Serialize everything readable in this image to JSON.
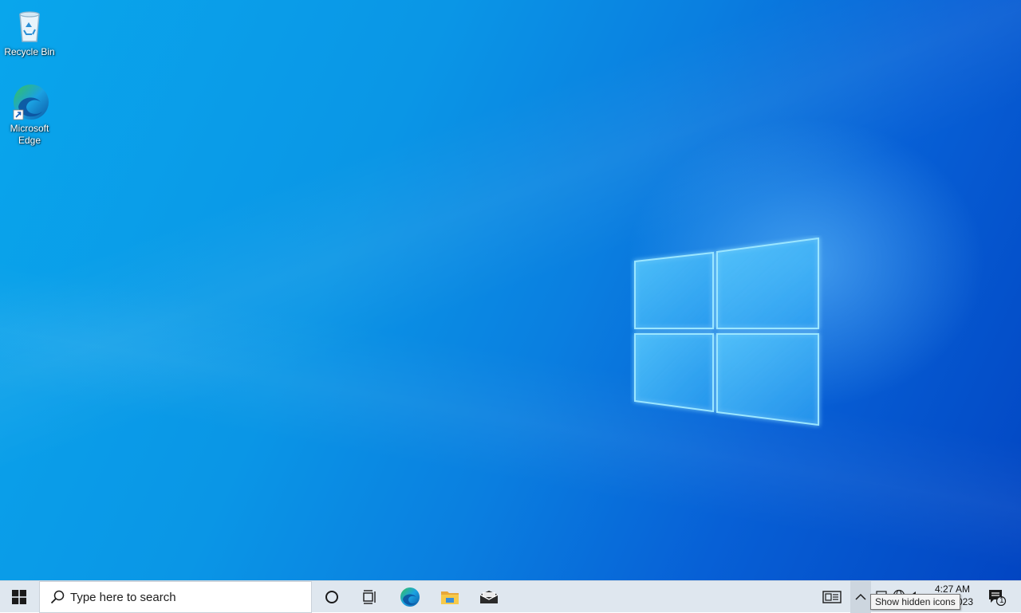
{
  "desktop": {
    "icons": [
      {
        "label": "Recycle Bin",
        "icon": "recycle-bin-icon"
      },
      {
        "label": "Microsoft Edge",
        "icon": "edge-icon"
      }
    ]
  },
  "taskbar": {
    "start_icon": "windows-start-icon",
    "search_placeholder": "Type here to search",
    "pinned": [
      {
        "name": "Cortana",
        "icon": "cortana-icon"
      },
      {
        "name": "Task View",
        "icon": "task-view-icon"
      },
      {
        "name": "Microsoft Edge",
        "icon": "edge-icon"
      },
      {
        "name": "File Explorer",
        "icon": "folder-icon"
      },
      {
        "name": "Mail",
        "icon": "mail-icon"
      }
    ],
    "tray": {
      "news_icon": "news-widget-icon",
      "chevron_icon": "chevron-up-icon",
      "time": "4:27 AM",
      "date_fragment": "023",
      "notification_count": "1"
    },
    "tooltip": "Show hidden icons"
  },
  "colors": {
    "taskbar_bg": "#dfe7ef",
    "wallpaper_blue": "#0a7fe0"
  }
}
